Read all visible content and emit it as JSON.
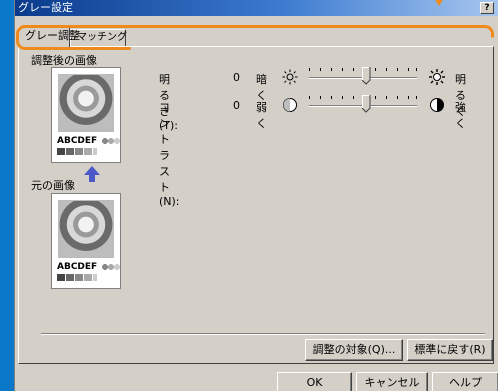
{
  "window": {
    "title": "グレー設定",
    "help_glyph": "?"
  },
  "tabs": [
    {
      "label": "グレー調整",
      "active": true
    },
    {
      "label": "マッチング",
      "active": false
    }
  ],
  "preview": {
    "after_label": "調整後の画像",
    "before_label": "元の画像",
    "sample_text": "ABCDEF"
  },
  "brightness": {
    "name": "明るさ(T):",
    "value": "0",
    "low_label": "暗く",
    "high_label": "明るく",
    "low_icon": "dim-sun-icon",
    "high_icon": "bright-sun-icon"
  },
  "contrast": {
    "name": "コントラスト(N):",
    "value": "0",
    "low_label": "弱く",
    "high_label": "強く",
    "low_icon": "low-contrast-icon",
    "high_icon": "high-contrast-icon"
  },
  "buttons": {
    "target": "調整の対象(Q)...",
    "reset": "標準に戻す(R)",
    "ok": "OK",
    "cancel": "キャンセル",
    "help": "ヘルプ"
  },
  "colors": {
    "highlight": "#f08a1d",
    "title_start": "#0a3a8c",
    "side_bar": "#0a77c8"
  }
}
